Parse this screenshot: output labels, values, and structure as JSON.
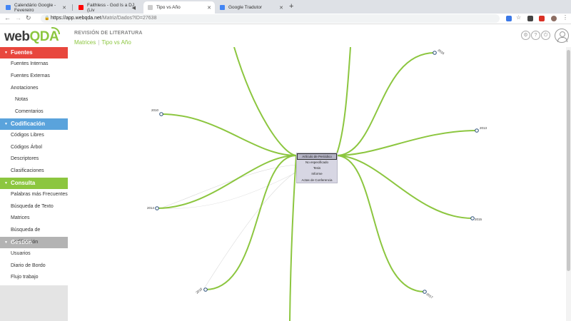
{
  "browser": {
    "tabs": [
      {
        "title": "Calendário Google - Fevereiro",
        "favicon_color": "#4285f4",
        "active": false
      },
      {
        "title": "Faithless - God Is a DJ (Liv",
        "favicon_color": "#ff0000",
        "active": false
      },
      {
        "title": "Tipo vs Año",
        "favicon_color": "#cccccc",
        "active": false
      },
      {
        "title": "Google Tradutor",
        "favicon_color": "#4285f4",
        "active": false
      }
    ],
    "new_tab": "+",
    "url_domain": "https://app.webqda.net",
    "url_path": "/Matriz/Dados?ID=27638"
  },
  "app": {
    "logo_web": "web",
    "logo_qda": "QDA",
    "page_heading": "REVISIÓN DE LITERATURA",
    "breadcrumb": [
      "Matrices",
      "Tipo vs Año"
    ]
  },
  "sidebar": {
    "sections": [
      {
        "title": "Fuentes",
        "color": "#e8473d",
        "items": [
          {
            "label": "Fuentes Internas",
            "sub": false
          },
          {
            "label": "Fuentes Externas",
            "sub": false
          },
          {
            "label": "Anotaciones",
            "sub": false
          },
          {
            "label": "Notas",
            "sub": true
          },
          {
            "label": "Comentarios",
            "sub": true
          }
        ]
      },
      {
        "title": "Codificación",
        "color": "#5aa3dc",
        "items": [
          {
            "label": "Códigos Libres",
            "sub": false
          },
          {
            "label": "Códigos Árbol",
            "sub": false
          },
          {
            "label": "Descriptores",
            "sub": false
          },
          {
            "label": "Clasificaciones",
            "sub": false
          }
        ]
      },
      {
        "title": "Consulta",
        "color": "#8cc63f",
        "items": [
          {
            "label": "Palabras más Frecuentes",
            "sub": false
          },
          {
            "label": "Búsqueda de Texto",
            "sub": false
          },
          {
            "label": "Matrices",
            "sub": false
          },
          {
            "label": "Búsqueda de Codificación",
            "sub": false
          }
        ]
      },
      {
        "title": "Gestión",
        "color": "#b3b3b3",
        "items": [
          {
            "label": "Usuarios",
            "sub": false
          },
          {
            "label": "Diario de Bordo",
            "sub": false
          },
          {
            "label": "Flujo trabajo",
            "sub": false
          }
        ]
      }
    ]
  },
  "graph": {
    "center_items": [
      "Artículo de Periódico",
      "No especificado",
      "Tesis",
      "Informe",
      "Actas de Conferencia"
    ],
    "year_nodes": [
      "2016",
      "2010",
      "2013",
      "2014",
      "2015",
      "2018",
      "2017"
    ],
    "edge_color": "#8cc63f"
  }
}
